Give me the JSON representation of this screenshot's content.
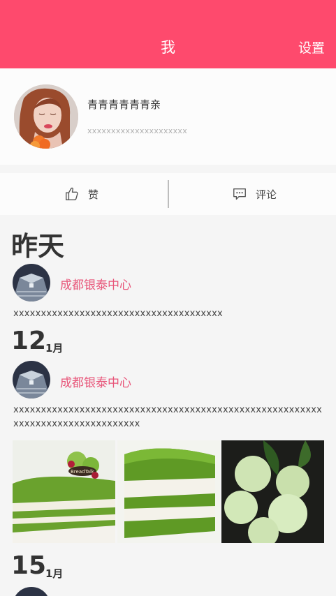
{
  "header": {
    "title": "我",
    "settings_label": "设置"
  },
  "profile": {
    "name": "青青青青青青亲",
    "subtitle": "xxxxxxxxxxxxxxxxxxxxx"
  },
  "actions": {
    "like_label": "赞",
    "comment_label": "评论"
  },
  "feed": {
    "sections": [
      {
        "heading": "昨天",
        "location": "成都银泰中心",
        "text": "xxxxxxxxxxxxxxxxxxxxxxxxxxxxxxxxxxxxxx"
      },
      {
        "day": "12",
        "month": "1月",
        "location": "成都银泰中心",
        "text": "xxxxxxxxxxxxxxxxxxxxxxxxxxxxxxxxxxxxxxxxxxxxxxxxxxxxxxxxxxxxxxxxxxxxxxxxxxxxxxx",
        "photos": [
          "matcha-cake-photo",
          "matcha-layer-cake-photo",
          "coconut-mochi-photo"
        ],
        "photo_labels": {
          "cake_brand": "BreadTalk"
        }
      },
      {
        "day": "15",
        "month": "1月"
      }
    ]
  },
  "colors": {
    "accent": "#fe4a6d",
    "location": "#e8567a",
    "background": "#f5f5f5"
  }
}
